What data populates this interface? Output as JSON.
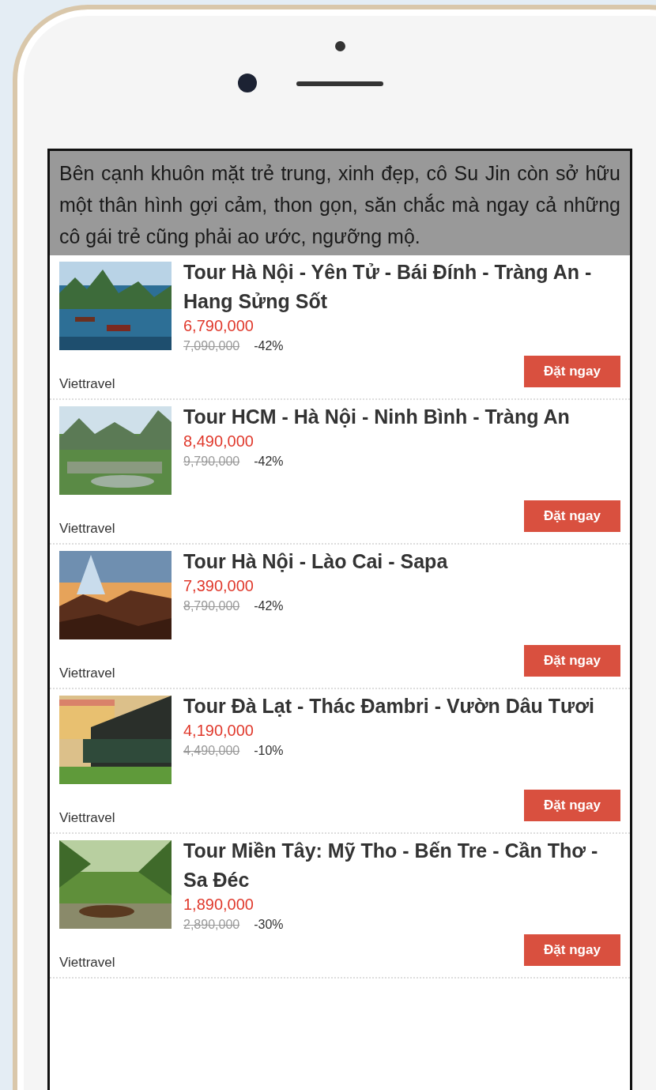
{
  "caption": "Bên cạnh khuôn mặt trẻ trung, xinh đẹp, cô Su Jin còn sở hữu một thân hình gợi cảm, thon gọn, săn chắc mà ngay cả những cô gái trẻ cũng phải ao ước, ngưỡng mộ.",
  "tours": [
    {
      "title": "Tour Hà Nội - Yên Tử - Bái Đính - Tràng An - Hang Sửng Sốt",
      "price": "6,790,000",
      "old_price": "7,090,000",
      "discount": "-42%",
      "provider": "Viettravel",
      "button": "Đặt ngay"
    },
    {
      "title": "Tour HCM - Hà Nội - Ninh Bình - Tràng An",
      "price": "8,490,000",
      "old_price": "9,790,000",
      "discount": "-42%",
      "provider": "Viettravel",
      "button": "Đặt ngay"
    },
    {
      "title": "Tour Hà Nội - Lào Cai - Sapa",
      "price": "7,390,000",
      "old_price": "8,790,000",
      "discount": "-42%",
      "provider": "Viettravel",
      "button": "Đặt ngay"
    },
    {
      "title": "Tour Đà Lạt - Thác Đambri - Vườn Dâu Tươi",
      "price": "4,190,000",
      "old_price": "4,490,000",
      "discount": "-10%",
      "provider": "Viettravel",
      "button": "Đặt ngay"
    },
    {
      "title": "Tour Miền Tây: Mỹ Tho - Bến Tre - Cần Thơ - Sa Đéc",
      "price": "1,890,000",
      "old_price": "2,890,000",
      "discount": "-30%",
      "provider": "Viettravel",
      "button": "Đặt ngay"
    }
  ]
}
